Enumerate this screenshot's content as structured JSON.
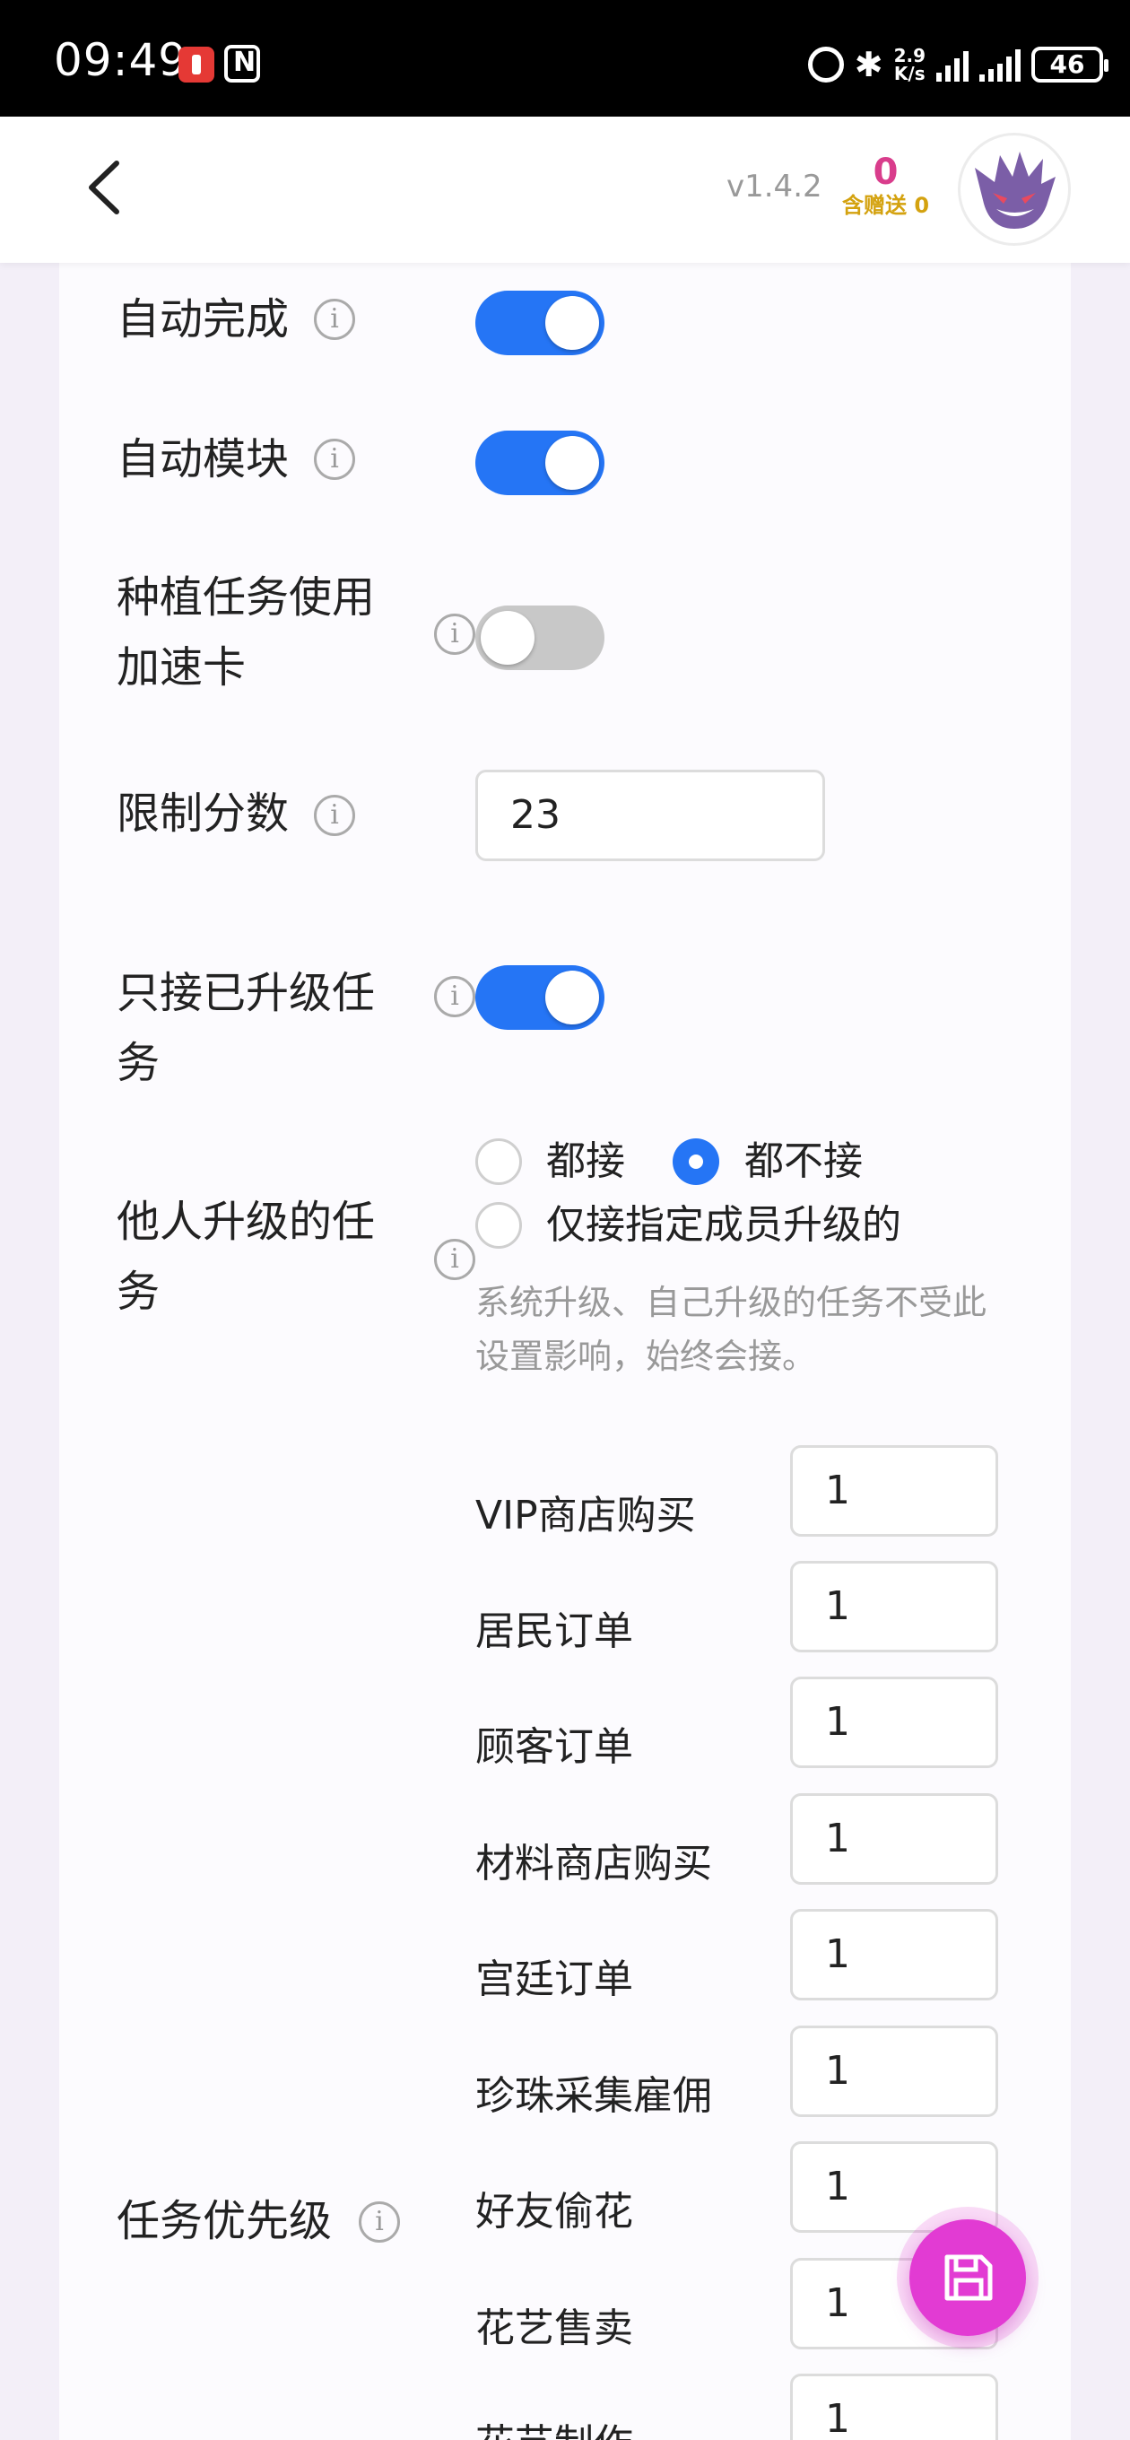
{
  "status_bar": {
    "time": "09:49",
    "net_speed_value": "2.9",
    "net_speed_unit": "K/s",
    "battery": "46"
  },
  "header": {
    "version": "v1.4.2",
    "coin_count": "0",
    "gift_label": "含赠送 0"
  },
  "settings": {
    "auto_complete": {
      "label": "自动完成",
      "on": true
    },
    "auto_module": {
      "label": "自动模块",
      "on": true
    },
    "planting_speedup": {
      "label_line1": "种植任务使用",
      "label_line2": "加速卡",
      "on": false
    },
    "score_limit": {
      "label": "限制分数",
      "value": "23"
    },
    "upgraded_only": {
      "label_line1": "只接已升级任",
      "label_line2": "务",
      "on": true
    },
    "others_upgraded": {
      "label_line1": "他人升级的任",
      "label_line2": "务",
      "options": [
        "都接",
        "都不接",
        "仅接指定成员升级的"
      ],
      "selected": "都不接",
      "hint_line1": "系统升级、自己升级的任务不受此",
      "hint_line2": "设置影响，始终会接。"
    },
    "task_priority": {
      "label": "任务优先级",
      "items": [
        {
          "name": "VIP商店购买",
          "value": "1"
        },
        {
          "name": "居民订单",
          "value": "1"
        },
        {
          "name": "顾客订单",
          "value": "1"
        },
        {
          "name": "材料商店购买",
          "value": "1"
        },
        {
          "name": "宫廷订单",
          "value": "1"
        },
        {
          "name": "珍珠采集雇佣",
          "value": "1"
        },
        {
          "name": "好友偷花",
          "value": "1"
        },
        {
          "name": "花艺售卖",
          "value": "1"
        },
        {
          "name": "花艺制作",
          "value": "1"
        }
      ]
    }
  },
  "icons": {
    "back": "chevron-left-icon",
    "info": "info-icon",
    "save": "save-icon",
    "avatar": "gengar-avatar"
  },
  "colors": {
    "accent": "#2575f5",
    "coin": "#d93d8c",
    "gift": "#d4a20f",
    "fab": "#e23bd3"
  }
}
